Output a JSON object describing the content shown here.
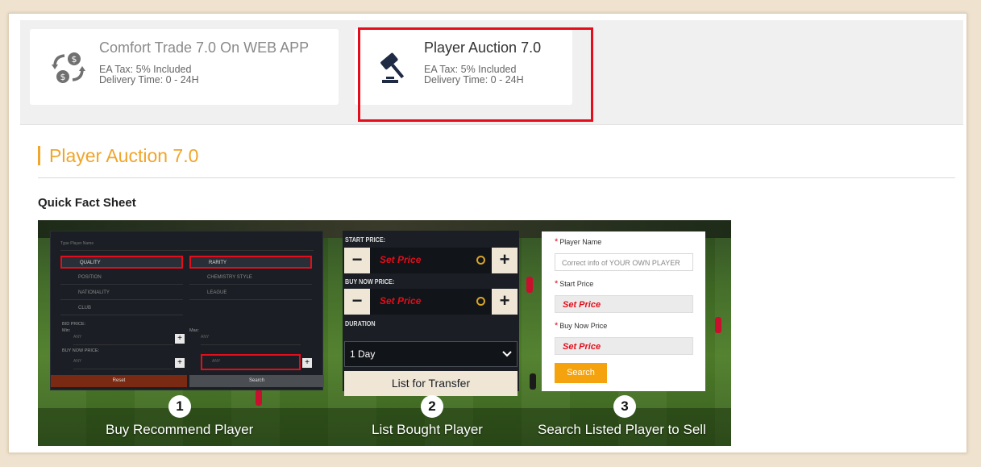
{
  "tabs": [
    {
      "title": "Comfort Trade 7.0 On WEB APP",
      "tax": "EA Tax: 5% Included",
      "delivery": "Delivery Time: 0 - 24H",
      "icon": "coin-exchange-icon",
      "selected": false
    },
    {
      "title": "Player Auction 7.0",
      "tax": "EA Tax: 5% Included",
      "delivery": "Delivery Time: 0 - 24H",
      "icon": "auction-gavel-icon",
      "selected": true
    }
  ],
  "section": {
    "title": "Player Auction 7.0",
    "subheading": "Quick Fact Sheet"
  },
  "colors": {
    "accent": "#f0a52b",
    "selection": "#e30d1b",
    "search_button": "#f4a20d"
  },
  "banner": {
    "panel1": {
      "search_placeholder": "Type Player Name",
      "filters": [
        "QUALITY",
        "RARITY",
        "POSITION",
        "CHEMISTRY STYLE",
        "NATIONALITY",
        "LEAGUE",
        "CLUB"
      ],
      "bid_price_label": "BID PRICE:",
      "buy_now_price_label": "BUY NOW PRICE:",
      "min_label": "Min:",
      "max_label": "Max:",
      "any": "ANY",
      "reset": "Reset",
      "search": "Search"
    },
    "panel2": {
      "start_price_label": "START PRICE:",
      "buy_now_price_label": "BUY NOW PRICE:",
      "set_price": "Set Price",
      "duration_label": "DURATION",
      "duration_value": "1 Day",
      "list_button": "List for Transfer"
    },
    "panel3": {
      "player_name_label": "Player Name",
      "player_name_placeholder": "Correct info of YOUR OWN PLAYER",
      "start_price_label": "Start Price",
      "buy_now_label": "Buy Now Price",
      "set_price": "Set Price",
      "search_button": "Search"
    },
    "steps": [
      {
        "num": "1",
        "label": "Buy Recommend Player"
      },
      {
        "num": "2",
        "label": "List Bought Player"
      },
      {
        "num": "3",
        "label": "Search Listed Player to Sell"
      }
    ]
  }
}
